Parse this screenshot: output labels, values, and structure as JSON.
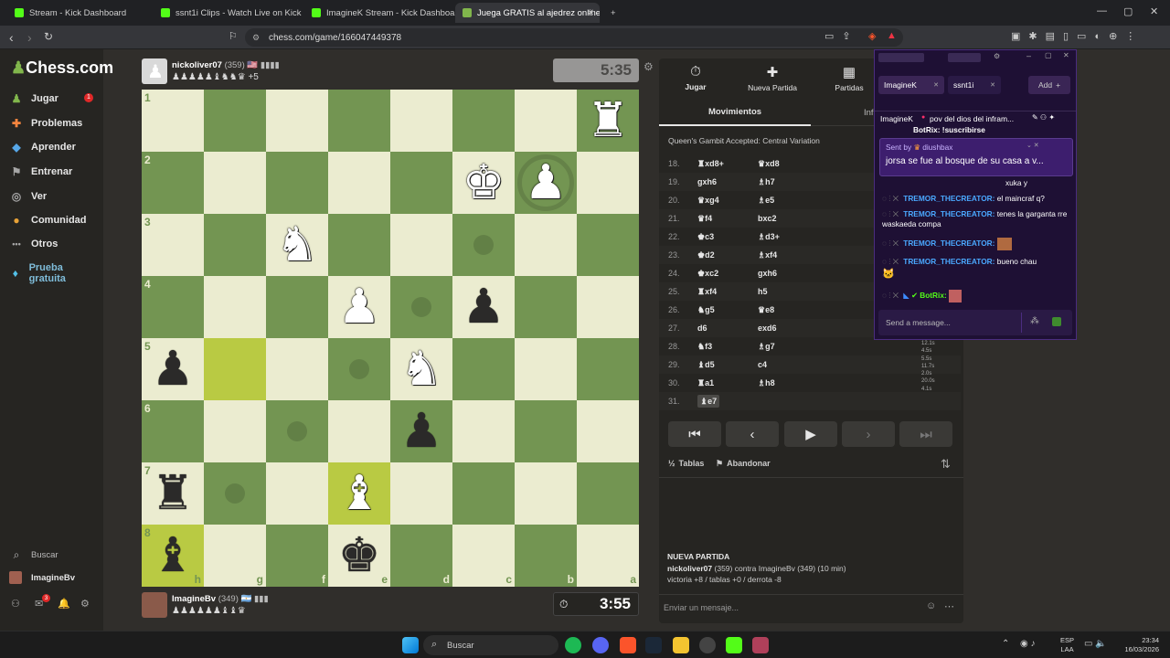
{
  "browser": {
    "tabs": [
      {
        "label": "Stream - Kick Dashboard",
        "color": "#53fc18"
      },
      {
        "label": "ssnt1i Clips - Watch Live on Kick",
        "color": "#53fc18"
      },
      {
        "label": "ImagineK Stream - Kick Dashboard",
        "color": "#53fc18"
      },
      {
        "label": "Juega GRATIS al ajedrez online -",
        "color": "#81b64c"
      }
    ],
    "url": "chess.com/game/166047449378"
  },
  "sidebar": {
    "logo": "Chess.com",
    "items": [
      {
        "label": "Jugar",
        "icon": "♟",
        "color": "#81b64c"
      },
      {
        "label": "Problemas",
        "icon": "✚",
        "color": "#f5853f"
      },
      {
        "label": "Aprender",
        "icon": "◆",
        "color": "#57a7e8"
      },
      {
        "label": "Entrenar",
        "icon": "⚑",
        "color": "#a6a6a6"
      },
      {
        "label": "Ver",
        "icon": "◎",
        "color": "#a6a6a6"
      },
      {
        "label": "Comunidad",
        "icon": "●",
        "color": "#e8a237"
      },
      {
        "label": "Otros",
        "icon": "•••",
        "color": "#a6a6a6"
      },
      {
        "label": "Prueba gratuita",
        "icon": "♦",
        "color": "#53c1e8"
      }
    ],
    "jugar_badge": "1",
    "search": "Buscar",
    "user": "ImagineBv",
    "mail_badge": "3"
  },
  "top_player": {
    "name": "nickoliver07",
    "rating": "(359)",
    "flag": "🇺🇸 ▮▮▮▮",
    "captured": "♟♟♟♟♟♝♞♞♛ +5",
    "clock": "5:35"
  },
  "bottom_player": {
    "name": "ImagineBv",
    "rating": "(349)",
    "flag": "🇦🇷 ▮▮▮",
    "captured": "♟♟♟♟♟♟♝♝♛",
    "clock": "3:55"
  },
  "board": {
    "ranks": [
      "1",
      "2",
      "3",
      "4",
      "5",
      "6",
      "7",
      "8"
    ],
    "files": [
      "h",
      "g",
      "f",
      "e",
      "d",
      "c",
      "b",
      "a"
    ],
    "pieces": [
      {
        "sq": "1-8",
        "glyph": "♜",
        "color": "w"
      },
      {
        "sq": "2-6",
        "glyph": "♚",
        "color": "w"
      },
      {
        "sq": "2-7",
        "glyph": "♟",
        "color": "w"
      },
      {
        "sq": "3-3",
        "glyph": "♞",
        "color": "w"
      },
      {
        "sq": "4-4",
        "glyph": "♟",
        "color": "w"
      },
      {
        "sq": "4-6",
        "glyph": "♟",
        "color": "b"
      },
      {
        "sq": "5-1",
        "glyph": "♟",
        "color": "b"
      },
      {
        "sq": "5-5",
        "glyph": "♞",
        "color": "w"
      },
      {
        "sq": "6-5",
        "glyph": "♟",
        "color": "b"
      },
      {
        "sq": "7-1",
        "glyph": "♜",
        "color": "b"
      },
      {
        "sq": "7-4",
        "glyph": "♝",
        "color": "w"
      },
      {
        "sq": "8-1",
        "glyph": "♝",
        "color": "b"
      },
      {
        "sq": "8-4",
        "glyph": "♚",
        "color": "b"
      }
    ],
    "highlights": [
      "5-2",
      "7-4",
      "8-1"
    ],
    "move_dots": [
      "3-6",
      "4-5",
      "5-4",
      "6-3",
      "7-2"
    ],
    "capture_ring": "2-7"
  },
  "panel": {
    "tabs": [
      {
        "label": "Jugar",
        "icon": "⏱"
      },
      {
        "label": "Nueva Partida",
        "icon": "✚"
      },
      {
        "label": "Partidas",
        "icon": "▦"
      }
    ],
    "subtab": "Movimientos",
    "subtab2": "Inf",
    "opening": "Queen's Gambit Accepted: Central Variation",
    "moves": [
      {
        "n": "18.",
        "w": "♜xd8+",
        "b": "♛xd8"
      },
      {
        "n": "19.",
        "w": "gxh6",
        "b": "♗h7"
      },
      {
        "n": "20.",
        "w": "♛xg4",
        "b": "♗e5"
      },
      {
        "n": "21.",
        "w": "♛f4",
        "b": "bxc2"
      },
      {
        "n": "22.",
        "w": "♚c3",
        "b": "♗d3+"
      },
      {
        "n": "23.",
        "w": "♚d2",
        "b": "♗xf4"
      },
      {
        "n": "24.",
        "w": "♚xc2",
        "b": "gxh6"
      },
      {
        "n": "25.",
        "w": "♜xf4",
        "b": "h5"
      },
      {
        "n": "26.",
        "w": "♞g5",
        "b": "♛e8"
      },
      {
        "n": "27.",
        "w": "d6",
        "b": "exd6"
      },
      {
        "n": "28.",
        "w": "♞f3",
        "b": "♗g7"
      },
      {
        "n": "29.",
        "w": "♝d5",
        "b": "c4"
      },
      {
        "n": "30.",
        "w": "♜a1",
        "b": "♗h8"
      },
      {
        "n": "31.",
        "w": "♝e7",
        "b": ""
      }
    ],
    "times": [
      "12.1s",
      "4.5s",
      "5.5s",
      "11.7s",
      "2.0s",
      "20.0s",
      "4.1s"
    ],
    "draw": "Tablas",
    "resign": "Abandonar",
    "new_game_title": "NUEVA PARTIDA",
    "new_game_line1_name": "nickoliver07",
    "new_game_line1_rest": "(359) contra ImagineBv (349) (10 min)",
    "new_game_line2": "victoria +8 / tablas +0 / derrota -8",
    "chat_placeholder": "Enviar un mensaje..."
  },
  "stream_chat": {
    "tag1": "ImagineK",
    "tag2": "ssnt1i",
    "add": "Add",
    "title_user": "ImagineK",
    "title_text": "pov del dios del infram...",
    "partial_top": "BotRix: !suscribirse",
    "sent_by_label": "Sent by",
    "sent_by_user": "diushbax",
    "highlight": "jorsa se fue al bosque de su casa a v...",
    "messages": [
      {
        "user": "",
        "text": "xuka y"
      },
      {
        "user": "TREMOR_THECREATOR:",
        "text": "el maincraf q?"
      },
      {
        "user": "TREMOR_THECREATOR:",
        "text": "tenes la garganta rre waskaeda compa"
      },
      {
        "user": "TREMOR_THECREATOR:",
        "text": ""
      },
      {
        "user": "TREMOR_THECREATOR:",
        "text": "bueno chau"
      },
      {
        "user": "BotRix:",
        "text": ""
      }
    ],
    "input_placeholder": "Send a message..."
  },
  "taskbar": {
    "search": "Buscar",
    "lang1": "ESP",
    "lang2": "LAA",
    "time": "23:34",
    "date": "16/03/2026"
  }
}
